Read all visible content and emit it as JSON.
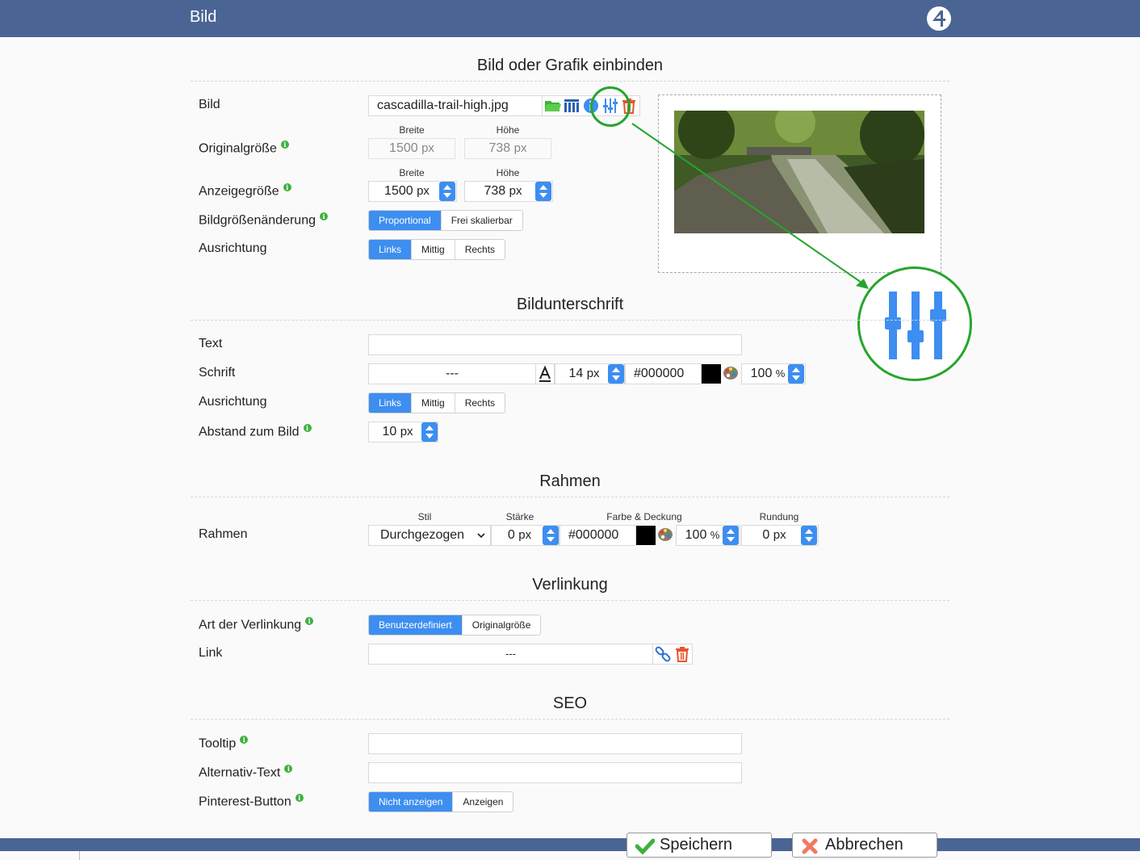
{
  "window": {
    "title": "Bild"
  },
  "sections": {
    "image": "Bild oder Grafik einbinden",
    "caption": "Bildunterschrift",
    "border": "Rahmen",
    "link": "Verlinkung",
    "seo": "SEO"
  },
  "image": {
    "label": "Bild",
    "filename": "cascadilla-trail-high.jpg",
    "original_size_label": "Originalgröße",
    "display_size_label": "Anzeigegröße",
    "width_label": "Breite",
    "height_label": "Höhe",
    "original_width": "1500",
    "original_height": "738",
    "display_width": "1500",
    "display_height": "738",
    "unit": "px",
    "resize_label": "Bildgrößenänderung",
    "resize_options": [
      "Proportional",
      "Frei skalierbar"
    ],
    "align_label": "Ausrichtung",
    "align_options": [
      "Links",
      "Mittig",
      "Rechts"
    ],
    "icons": [
      "folder-icon",
      "gallery-icon",
      "info-icon",
      "adjust-icon",
      "trash-icon"
    ]
  },
  "caption": {
    "text_label": "Text",
    "text_value": "",
    "font_label": "Schrift",
    "font_value": "---",
    "font_size": "14",
    "font_unit": "px",
    "color": "#000000",
    "opacity": "100",
    "opacity_unit": "%",
    "align_label": "Ausrichtung",
    "align_options": [
      "Links",
      "Mittig",
      "Rechts"
    ],
    "distance_label": "Abstand zum Bild",
    "distance_value": "10",
    "distance_unit": "px"
  },
  "border": {
    "label": "Rahmen",
    "style_label": "Stil",
    "width_label": "Stärke",
    "color_label": "Farbe & Deckung",
    "radius_label": "Rundung",
    "style_value": "Durchgezogen",
    "width_value": "0",
    "unit": "px",
    "color": "#000000",
    "opacity": "100",
    "opacity_unit": "%",
    "radius_value": "0"
  },
  "link": {
    "type_label": "Art der Verlinkung",
    "type_options": [
      "Benutzerdefiniert",
      "Originalgröße"
    ],
    "link_label": "Link",
    "link_value": "---"
  },
  "seo": {
    "tooltip_label": "Tooltip",
    "alt_label": "Alternativ-Text",
    "pinterest_label": "Pinterest-Button",
    "pinterest_options": [
      "Nicht anzeigen",
      "Anzeigen"
    ]
  },
  "actions": {
    "save": "Speichern",
    "cancel": "Abbrechen"
  },
  "colors": {
    "accent": "#3d8ef0",
    "header": "#4a6594",
    "highlight": "#26a52c",
    "delete": "#e8542a",
    "info": "#3db13d"
  }
}
